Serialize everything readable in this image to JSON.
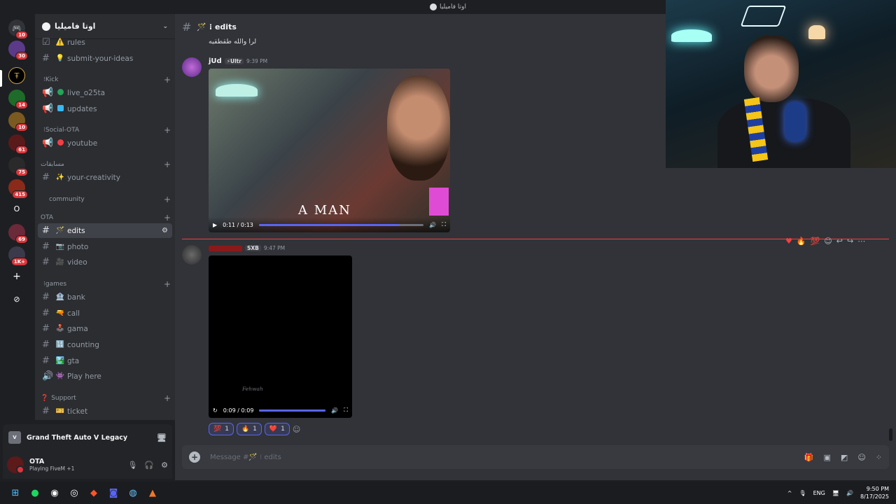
{
  "window_title": "اوتا فاميليا",
  "server_rail": {
    "servers": [
      {
        "name": "discord-home",
        "badge": "10"
      },
      {
        "name": "server-2",
        "badge": "30"
      },
      {
        "name": "server-ota",
        "badge": ""
      },
      {
        "name": "server-4",
        "badge": "14"
      },
      {
        "name": "server-5",
        "badge": "10"
      },
      {
        "name": "server-6",
        "badge": "61"
      },
      {
        "name": "server-7",
        "badge": "75"
      },
      {
        "name": "server-8",
        "badge": "415"
      },
      {
        "name": "server-9",
        "label": "O",
        "badge": ""
      },
      {
        "name": "server-10",
        "badge": "69"
      },
      {
        "name": "server-11",
        "badge": "1K+"
      }
    ]
  },
  "sidebar": {
    "guild_name": "اوتا فاميليا",
    "channels_top": [
      {
        "name": "rules",
        "icon": "⚠️"
      },
      {
        "name": "submit-your-ideas",
        "icon": "💡"
      }
    ],
    "cat_kick": "Kick",
    "kick": [
      {
        "name": "live_o25ta",
        "icon_color": "#23a55a"
      },
      {
        "name": "updates",
        "icon_color": "#3ab8f0"
      }
    ],
    "cat_social": "Social-OTA",
    "social": [
      {
        "name": "youtube",
        "icon_color": "#f23f43"
      }
    ],
    "cat_contests": "مسابقات",
    "contests": [
      {
        "name": "your-creativity",
        "icon": "✨"
      }
    ],
    "cat_community": "community",
    "cat_ota": "OTA",
    "ota": [
      {
        "name": "edits",
        "icon": "🪄",
        "active": true
      },
      {
        "name": "photo",
        "icon": "📷"
      },
      {
        "name": "video",
        "icon": "🎥"
      }
    ],
    "cat_games": "games",
    "games": [
      {
        "name": "bank",
        "icon": "🏦"
      },
      {
        "name": "call",
        "icon": "🔫"
      },
      {
        "name": "gama",
        "icon": "🕹️"
      },
      {
        "name": "counting",
        "icon": "🔢"
      },
      {
        "name": "gta",
        "icon": "🏞️"
      },
      {
        "name": "Play here",
        "icon": "👾"
      }
    ],
    "cat_support": "Support",
    "support": [
      {
        "name": "ticket",
        "icon": "🎫"
      }
    ]
  },
  "activity": {
    "game": "Grand Theft Auto V Legacy"
  },
  "user": {
    "name": "OTA",
    "status": "Playing FiveM",
    "extra": "+1"
  },
  "channel_header": {
    "name": "edits",
    "prefix": "🪄 ⁝"
  },
  "messages": [
    {
      "text_only": "لرا والله طقطقيه"
    },
    {
      "author": "jUd",
      "tag": "⚡Ultr",
      "time": "9:39 PM",
      "video": {
        "caption": "A MAN",
        "time": "0:11 / 0:13",
        "progress": 0.85
      }
    },
    {
      "author": "",
      "tag": "SXB",
      "time": "9:47 PM",
      "video": {
        "watermark": "Fehwah",
        "time": "0:09 / 0:09",
        "progress": 1.0
      },
      "reactions": [
        {
          "emoji": "💯",
          "count": "1"
        },
        {
          "emoji": "🔥",
          "count": "1"
        },
        {
          "emoji": "❤️",
          "count": "1"
        }
      ]
    }
  ],
  "composer": {
    "placeholder": "Message #🪄 ⁝ edits"
  },
  "taskbar": {
    "lang": "ENG",
    "time": "9:50 PM",
    "date": "8/17/2025"
  }
}
